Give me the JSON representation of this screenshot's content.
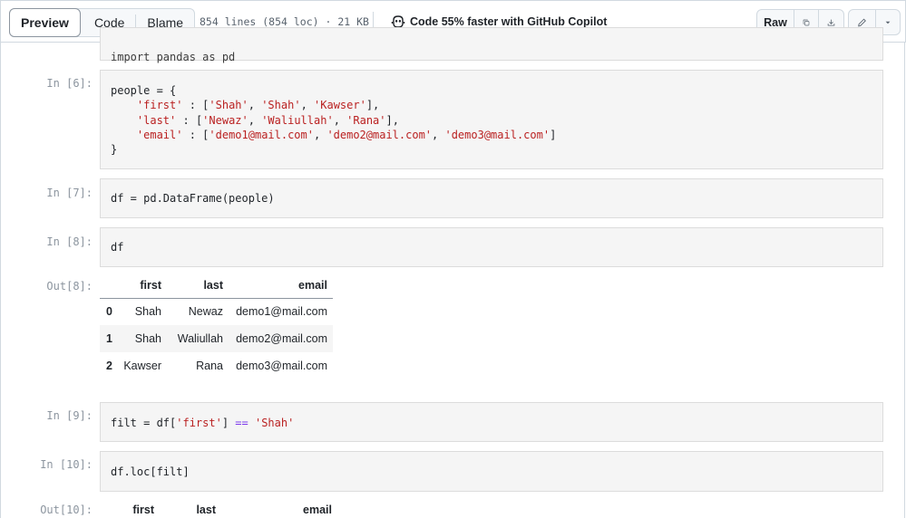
{
  "toolbar": {
    "tabs": [
      "Preview",
      "Code",
      "Blame"
    ],
    "meta": "854 lines (854 loc) · 21 KB",
    "copilot": "Code 55% faster with GitHub Copilot",
    "raw_label": "Raw"
  },
  "cells": {
    "c5_code": "import pandas as pd",
    "c6_prompt": "In [6]:",
    "c7_prompt": "In [7]:",
    "c7_code": "df = pd.DataFrame(people)",
    "c8_prompt": "In [8]:",
    "c8_code": "df",
    "o8_prompt": "Out[8]:",
    "c9_prompt": "In [9]:",
    "c10_prompt": "In [10]:",
    "c10_code": "df.loc[filt]",
    "o10_prompt": "Out[10]:"
  },
  "df_out8": {
    "columns": [
      "",
      "first",
      "last",
      "email"
    ],
    "rows": [
      {
        "index": "0",
        "first": "Shah",
        "last": "Newaz",
        "email": "demo1@mail.com"
      },
      {
        "index": "1",
        "first": "Shah",
        "last": "Waliullah",
        "email": "demo2@mail.com"
      },
      {
        "index": "2",
        "first": "Kawser",
        "last": "Rana",
        "email": "demo3@mail.com"
      }
    ]
  },
  "df_out10": {
    "columns": [
      "",
      "first",
      "last",
      "email"
    ]
  },
  "code6": {
    "l1_a": "people = {",
    "l2_k": "'first'",
    "l2_v1": "'Shah'",
    "l2_v2": "'Shah'",
    "l2_v3": "'Kawser'",
    "l3_k": "'last'",
    "l3_v1": "'Newaz'",
    "l3_v2": "'Waliullah'",
    "l3_v3": "'Rana'",
    "l4_k": "'email'",
    "l4_v1": "'demo1@mail.com'",
    "l4_v2": "'demo2@mail.com'",
    "l4_v3": "'demo3@mail.com'",
    "l5": "}"
  },
  "code9": {
    "a": "filt = df[",
    "s1": "'first'",
    "b": "] ",
    "op": "==",
    "s2": "'Shah'"
  },
  "colors": {
    "string": "#ba2121",
    "cell_bg": "#f5f5f5",
    "border": "#d1d9e0"
  }
}
